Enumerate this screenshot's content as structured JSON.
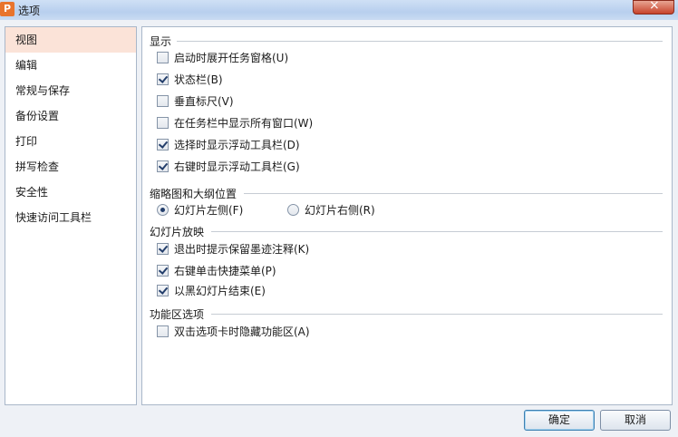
{
  "window": {
    "title": "选项",
    "app_icon_letter": "P"
  },
  "sidebar": {
    "items": [
      {
        "label": "视图",
        "active": true
      },
      {
        "label": "编辑"
      },
      {
        "label": "常规与保存"
      },
      {
        "label": "备份设置"
      },
      {
        "label": "打印"
      },
      {
        "label": "拼写检查"
      },
      {
        "label": "安全性"
      },
      {
        "label": "快速访问工具栏"
      }
    ]
  },
  "groups": {
    "display": {
      "title": "显示",
      "options": [
        {
          "label": "启动时展开任务窗格(U)",
          "checked": false
        },
        {
          "label": "状态栏(B)",
          "checked": true
        },
        {
          "label": "垂直标尺(V)",
          "checked": false
        },
        {
          "label": "在任务栏中显示所有窗口(W)",
          "checked": false
        },
        {
          "label": "选择时显示浮动工具栏(D)",
          "checked": true
        },
        {
          "label": "右键时显示浮动工具栏(G)",
          "checked": true
        }
      ]
    },
    "thumbnail": {
      "title": "缩略图和大纲位置",
      "options": [
        {
          "label": "幻灯片左侧(F)",
          "selected": true
        },
        {
          "label": "幻灯片右侧(R)",
          "selected": false
        }
      ]
    },
    "slideshow": {
      "title": "幻灯片放映",
      "options": [
        {
          "label": "退出时提示保留墨迹注释(K)",
          "checked": true
        },
        {
          "label": "右键单击快捷菜单(P)",
          "checked": true
        },
        {
          "label": "以黑幻灯片结束(E)",
          "checked": true
        }
      ]
    },
    "ribbon": {
      "title": "功能区选项",
      "options": [
        {
          "label": "双击选项卡时隐藏功能区(A)",
          "checked": false
        }
      ]
    }
  },
  "buttons": {
    "ok": "确定",
    "cancel": "取消"
  }
}
